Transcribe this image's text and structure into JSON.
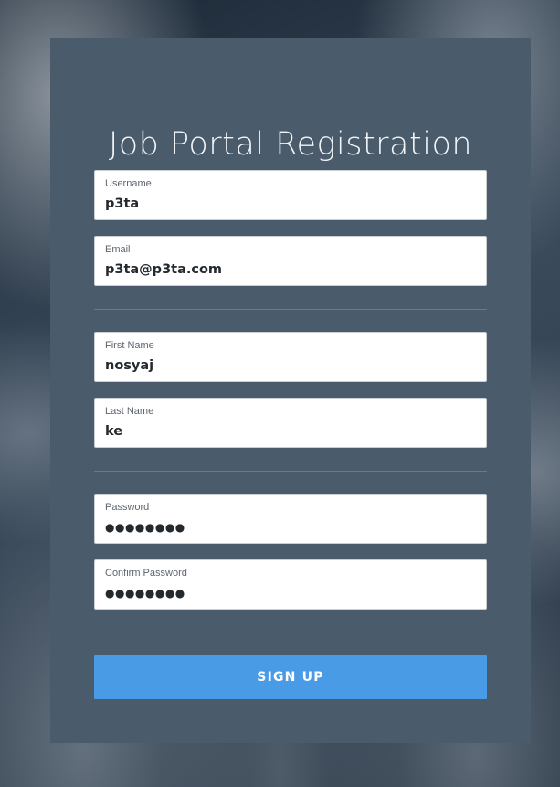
{
  "title": "Job Portal Registration",
  "fields": {
    "username": {
      "label": "Username",
      "value": "p3ta"
    },
    "email": {
      "label": "Email",
      "value": "p3ta@p3ta.com"
    },
    "first_name": {
      "label": "First Name",
      "value": "nosyaj"
    },
    "last_name": {
      "label": "Last Name",
      "value": "ke"
    },
    "password": {
      "label": "Password",
      "value": "●●●●●●●●"
    },
    "confirm_password": {
      "label": "Confirm Password",
      "value": "●●●●●●●●"
    }
  },
  "signup_button": {
    "label": "SIGN UP"
  },
  "colors": {
    "card": "#4a5b6b",
    "button": "#4a9be6",
    "field": "#ffffff"
  }
}
